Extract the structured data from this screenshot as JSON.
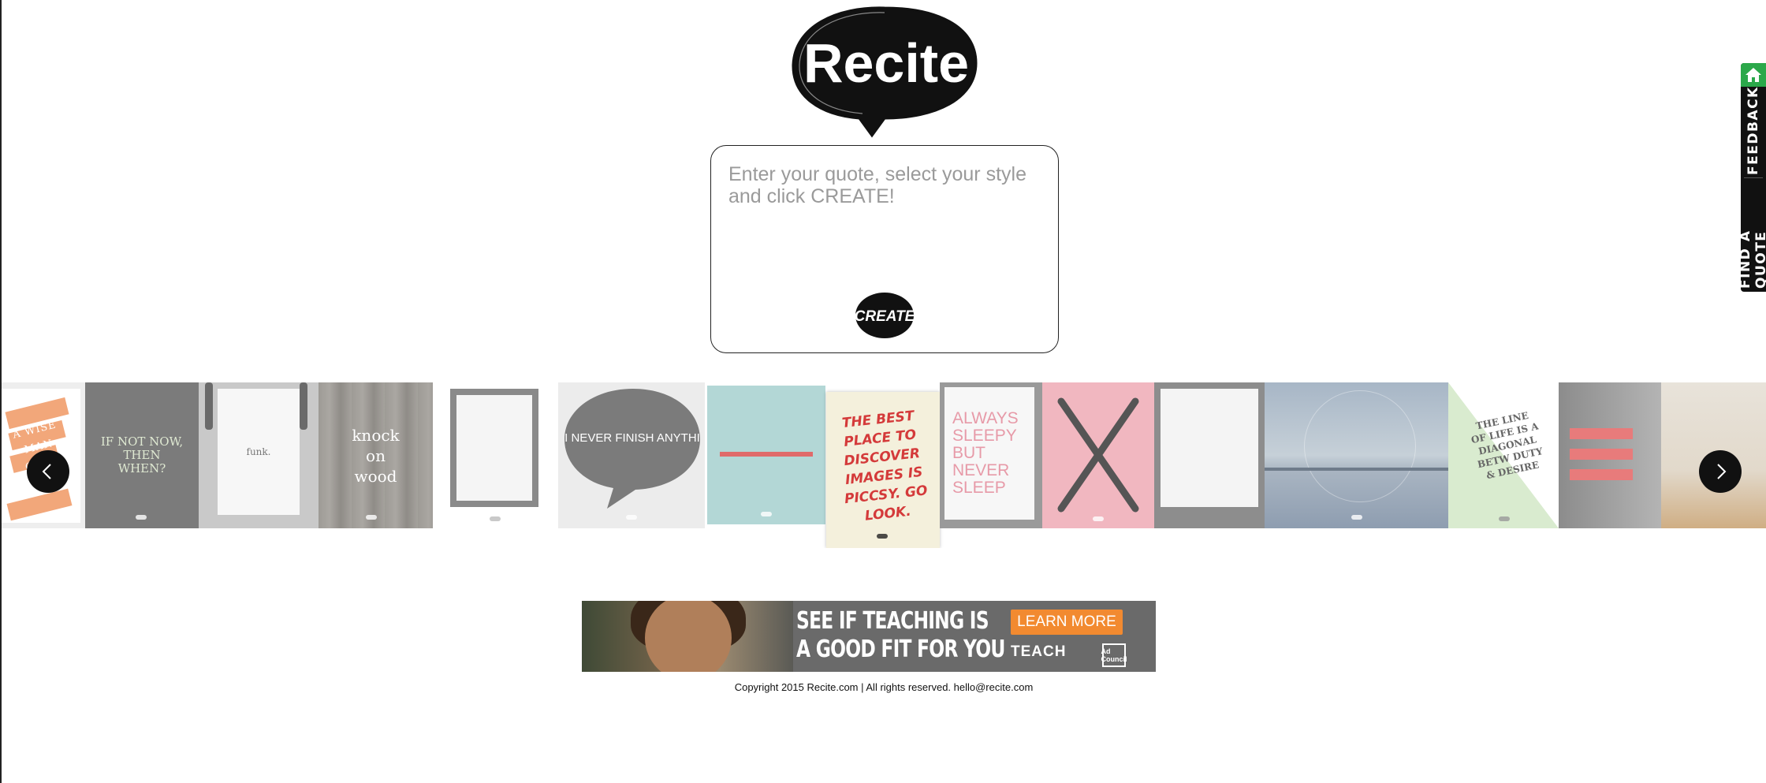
{
  "logo": {
    "text": "Recite"
  },
  "composer": {
    "placeholder": "Enter your quote, select your style and click CREATE!",
    "create_label": "CREATE"
  },
  "side_tabs": {
    "home_icon": "home-icon",
    "feedback_label": "FEEDBACK",
    "find_quote_label": "FIND A QUOTE"
  },
  "carousel": {
    "prev_icon": "chevron-left-icon",
    "next_icon": "chevron-right-icon",
    "tiles": [
      {
        "text": "A WISE MAN ONCE KNOW"
      },
      {
        "text": "IF NOT NOW, THEN WHEN?"
      },
      {
        "text": "funk."
      },
      {
        "text": "knock on wood"
      },
      {
        "text": ""
      },
      {
        "text": "I NEVER FINISH ANYTHI"
      },
      {
        "text": ""
      },
      {
        "text": "THE BEST PLACE TO DISCOVER IMAGES IS PICCSY. GO LOOK."
      },
      {
        "text": "ALWAYS SLEEPY BUT NEVER SLEEP"
      },
      {
        "text": ""
      },
      {
        "text": ""
      },
      {
        "text": ""
      },
      {
        "text": "THE LINE OF LIFE IS A DIAGONAL BETW DUTY & DESIRE"
      },
      {
        "text": ""
      },
      {
        "text": ""
      }
    ]
  },
  "ad": {
    "headline_line1": "SEE IF TEACHING IS",
    "headline_line2": "A GOOD FIT FOR YOU",
    "learn_more": "LEARN MORE",
    "brand": "TEACH",
    "council": "Ad Council"
  },
  "footer": {
    "copyright": "Copyright 2015 Recite.com | All rights reserved. hello@recite.com"
  },
  "colors": {
    "accent_green": "#2ba84a",
    "black": "#111111",
    "ad_orange": "#f28a30"
  }
}
